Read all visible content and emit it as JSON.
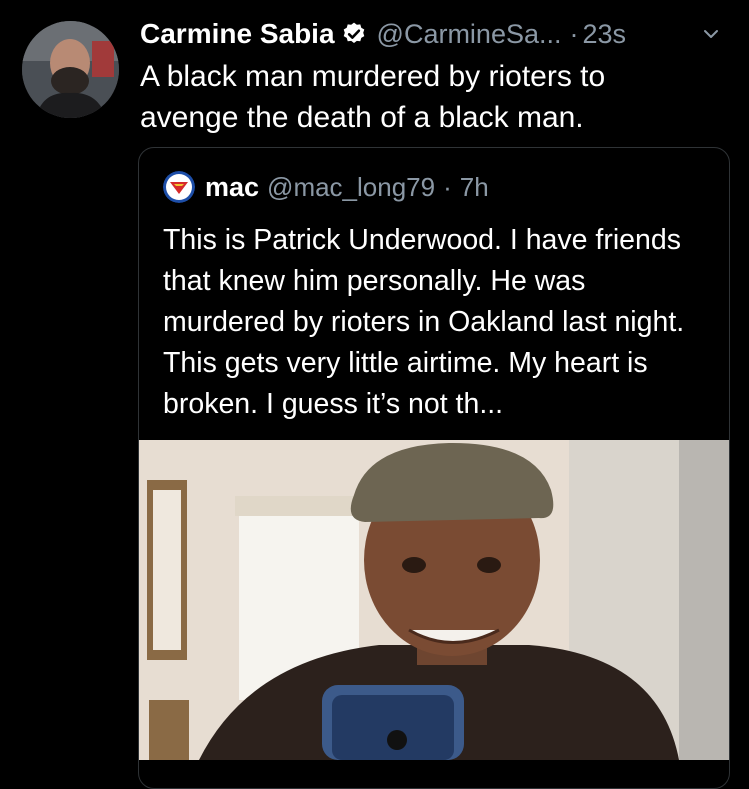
{
  "tweet": {
    "author_name": "Carmine Sabia",
    "handle": "@CarmineSa...",
    "separator": "·",
    "time": "23s",
    "text": "A black man murdered by rioters to avenge the death of a black man."
  },
  "quoted_tweet": {
    "author_name": "mac",
    "handle": "@mac_long79",
    "separator": "·",
    "time": "7h",
    "text": "This is Patrick Underwood. I have friends that knew him personally. He was murdered by rioters in Oakland last night. This gets very little airtime. My heart is broken. I guess it’s not th..."
  },
  "colors": {
    "background": "#000000",
    "secondary_text": "#8b98a5",
    "border": "#2f3336"
  },
  "icons": {
    "verified": "verified-badge-icon",
    "more": "chevron-down-icon"
  }
}
